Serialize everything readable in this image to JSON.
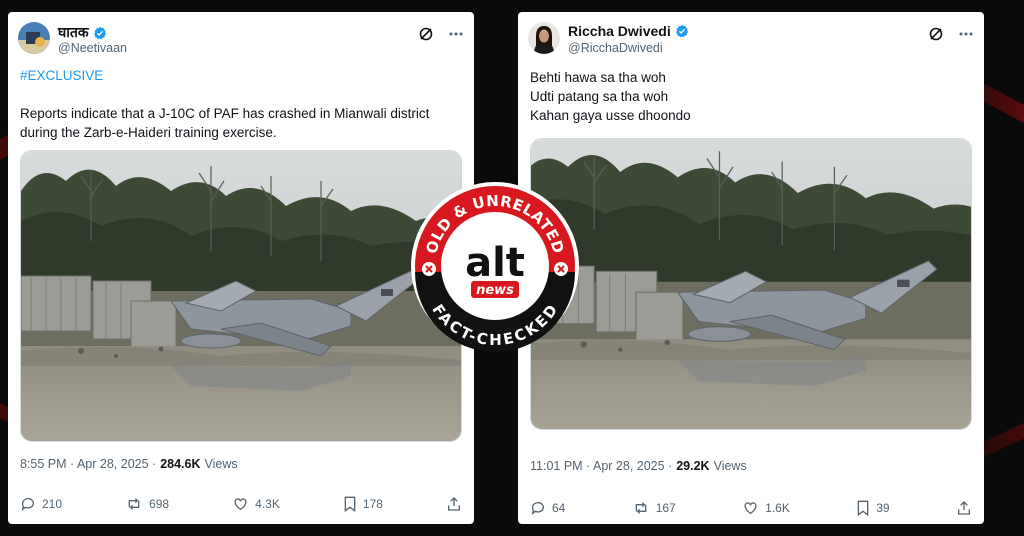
{
  "left_tweet": {
    "display_name": "घातक",
    "handle": "@Neetivaan",
    "hashtag": "#EXCLUSIVE",
    "body_lines": [
      "Reports indicate that a J-10C of PAF has crashed in Mianwali district",
      "during the Zarb-e-Haideri training exercise."
    ],
    "timestamp": "8:55 PM · Apr 28, 2025 ·",
    "views_count": "284.6K",
    "views_label": "Views",
    "replies": "210",
    "reposts": "698",
    "likes": "4.3K",
    "bookmarks": "178"
  },
  "right_tweet": {
    "display_name": "Riccha Dwivedi",
    "handle": "@RicchaDwivedi",
    "body_lines": [
      "Behti hawa sa tha woh",
      "Udti patang sa tha woh",
      "Kahan gaya usse dhoondo"
    ],
    "timestamp": "11:01 PM · Apr 28, 2025 ·",
    "views_count": "29.2K",
    "views_label": "Views",
    "replies": "64",
    "reposts": "167",
    "likes": "1.6K",
    "bookmarks": "39"
  },
  "badge": {
    "top_text": "OLD & UNRELATED",
    "bottom_text": "FACT-CHECKED",
    "logo_main": "alt",
    "logo_sub": "news"
  },
  "colors": {
    "verified": "#1d9bf0",
    "hashtag": "#1d9bf0",
    "badge_red": "#d7191f"
  },
  "icons": [
    "verified-badge-icon",
    "grok-icon",
    "more-icon",
    "reply-icon",
    "repost-icon",
    "like-icon",
    "bookmark-icon",
    "share-icon"
  ]
}
